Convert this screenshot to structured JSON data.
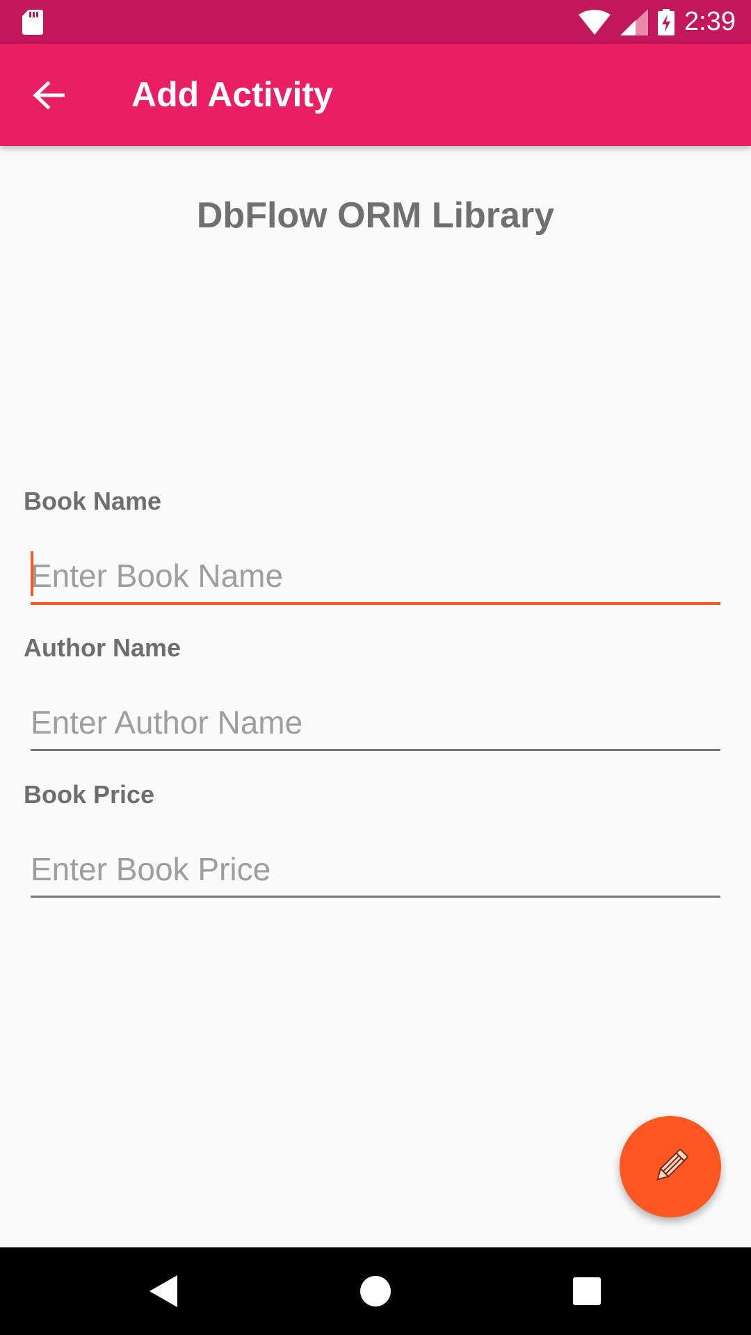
{
  "status_bar": {
    "time": "2:39",
    "icons": [
      "sd-card-icon",
      "wifi-icon",
      "signal-icon",
      "battery-charging-icon"
    ]
  },
  "app_bar": {
    "title": "Add Activity",
    "back_icon": "arrow-back-icon"
  },
  "main": {
    "heading": "DbFlow ORM Library",
    "fields": [
      {
        "label": "Book Name",
        "placeholder": "Enter Book Name",
        "value": "",
        "focused": true
      },
      {
        "label": "Author Name",
        "placeholder": "Enter Author Name",
        "value": ""
      },
      {
        "label": "Book Price",
        "placeholder": "Enter Book Price",
        "value": ""
      }
    ]
  },
  "fab": {
    "icon": "pencil-icon"
  },
  "nav_bar": {
    "buttons": [
      "back-triangle-icon",
      "home-circle-icon",
      "recents-square-icon"
    ]
  },
  "colors": {
    "status_bar": "#c2185b",
    "app_bar": "#e91e63",
    "accent": "#ff5722",
    "background": "#fafafa"
  }
}
